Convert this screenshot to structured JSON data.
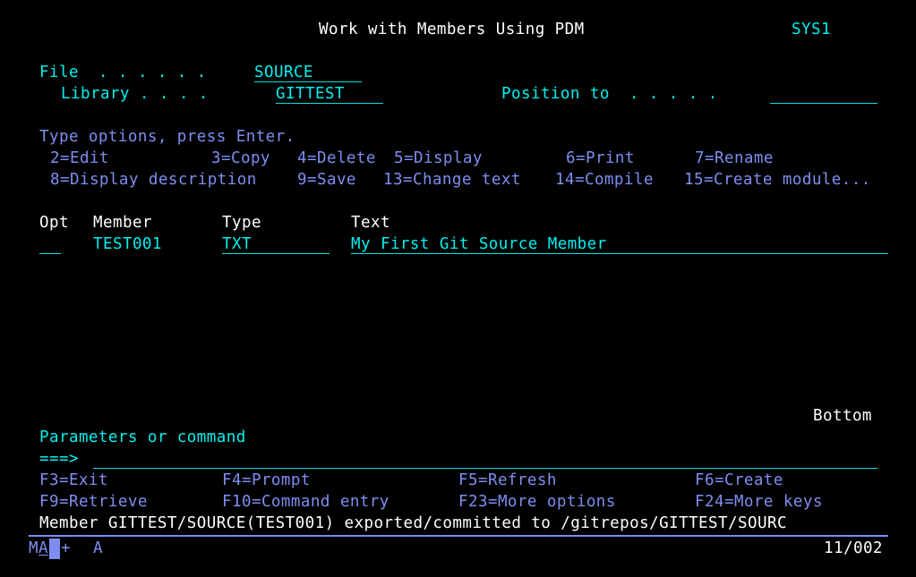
{
  "header": {
    "title": "Work with Members Using PDM",
    "system": "SYS1"
  },
  "fields": {
    "file_label": "File  . . . . . .",
    "file_value": "SOURCE",
    "library_label": "Library . . . .",
    "library_value": "GITTEST",
    "position_label": "Position to  . . . . .",
    "position_value": ""
  },
  "instructions": {
    "prompt": "Type options, press Enter.",
    "options_row1": [
      {
        "label": "2=Edit"
      },
      {
        "label": "3=Copy"
      },
      {
        "label": "4=Delete"
      },
      {
        "label": "5=Display"
      },
      {
        "label": "6=Print"
      },
      {
        "label": "7=Rename"
      }
    ],
    "options_row2": [
      {
        "label": "8=Display description"
      },
      {
        "label": "9=Save"
      },
      {
        "label": "13=Change text"
      },
      {
        "label": "14=Compile"
      },
      {
        "label": "15=Create module..."
      }
    ]
  },
  "table": {
    "columns": {
      "opt": "Opt",
      "member": "Member",
      "type": "Type",
      "text": "Text"
    },
    "rows": [
      {
        "opt": "",
        "member": "TEST001",
        "type": "TXT",
        "text": "My First Git Source Member"
      }
    ],
    "footer": "Bottom"
  },
  "command": {
    "label": "Parameters or command",
    "prompt": "===>",
    "value": ""
  },
  "function_keys": {
    "row1": [
      {
        "label": "F3=Exit"
      },
      {
        "label": "F4=Prompt"
      },
      {
        "label": "F5=Refresh"
      },
      {
        "label": "F6=Create"
      }
    ],
    "row2": [
      {
        "label": "F9=Retrieve"
      },
      {
        "label": "F10=Command entry"
      },
      {
        "label": "F23=More options"
      },
      {
        "label": "F24=More keys"
      }
    ]
  },
  "message": "Member GITTEST/SOURCE(TEST001) exported/committed to /gitrepos/GITTEST/SOURC",
  "status_bar": {
    "session": "MA",
    "mode_indicator": "+",
    "input_mode": "A",
    "cursor_position": "11/002"
  },
  "colors": {
    "background": "#000000",
    "title": "#ffffff",
    "field_text": "#00f0f0",
    "option_text": "#7e8ef0"
  }
}
